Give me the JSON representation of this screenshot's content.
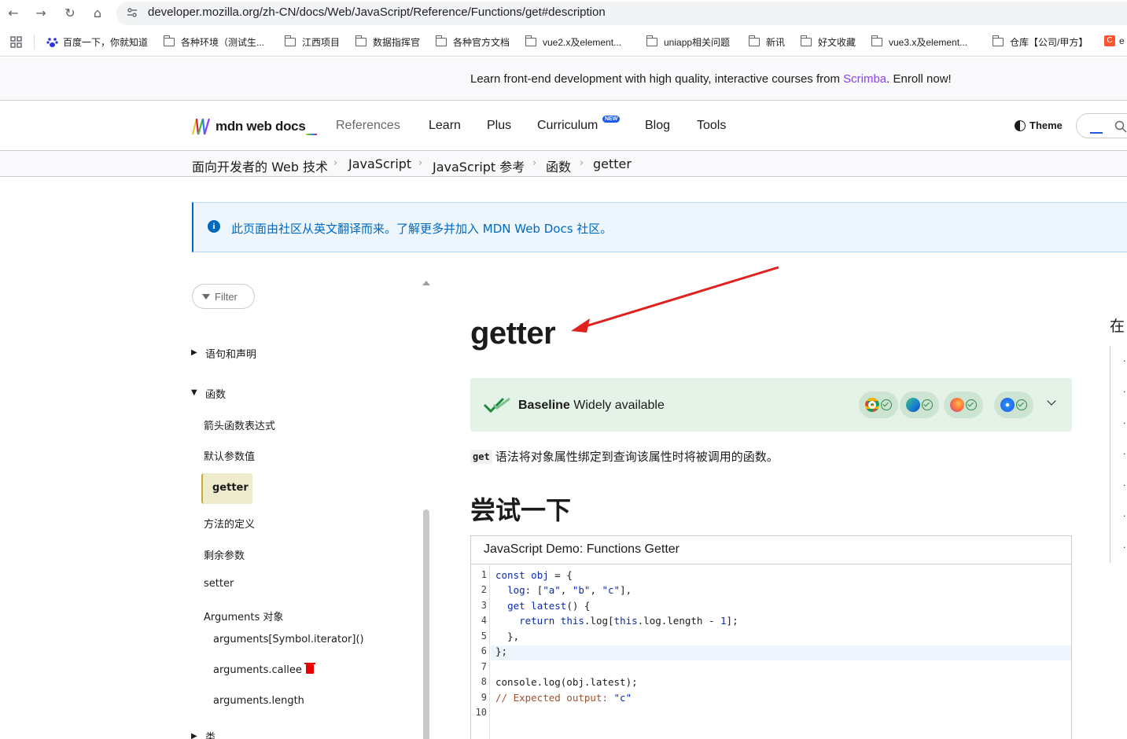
{
  "browser": {
    "url": "developer.mozilla.org/zh-CN/docs/Web/JavaScript/Reference/Functions/get#description",
    "bookmarks": [
      "百度一下，你就知道",
      "各种环境（测试生...",
      "江西项目",
      "数据指挥官",
      "各种官方文档",
      "vue2.x及element...",
      "uniapp相关问题",
      "新讯",
      "好文收藏",
      "vue3.x及element...",
      "仓库【公司/甲方】",
      "e"
    ]
  },
  "banner": {
    "prefix": "Learn front-end development with high quality, interactive courses from ",
    "link": "Scrimba",
    "suffix": ". Enroll now!"
  },
  "header": {
    "logo": "mdn web docs",
    "nav": [
      "References",
      "Learn",
      "Plus",
      "Curriculum",
      "Blog",
      "Tools"
    ],
    "new_badge": "NEW",
    "theme": "Theme"
  },
  "breadcrumb": [
    "面向开发者的 Web 技术",
    "JavaScript",
    "JavaScript 参考",
    "函数",
    "getter"
  ],
  "notice": {
    "text": "此页面由社区从英文翻译而来。了解更多并加入 MDN Web Docs 社区。"
  },
  "sidebar": {
    "filter": "Filter",
    "section_statements": "语句和声明",
    "section_functions": "函数",
    "items": [
      "箭头函数表达式",
      "默认参数值",
      "getter",
      "方法的定义",
      "剩余参数",
      "setter",
      "Arguments 对象"
    ],
    "sub_items": [
      "arguments[Symbol.iterator]()",
      "arguments.callee",
      "arguments.length"
    ],
    "section_classes": "类"
  },
  "main": {
    "title": "getter",
    "baseline_strong": "Baseline",
    "baseline_rest": " Widely available",
    "desc_code": "get",
    "desc_text": "语法将对象属性绑定到查询该属性时将被调用的函数。",
    "h2": "尝试一下",
    "demo_title": "JavaScript Demo: Functions Getter",
    "line_numbers": [
      "1",
      "2",
      "3",
      "4",
      "5",
      "6",
      "7",
      "8",
      "9",
      "10"
    ]
  },
  "toc": {
    "head": "在"
  },
  "colors": {
    "accent": "#1a5be8",
    "notice": "#0069c2",
    "baseline_bg": "#e4f2e7",
    "annotation_arrow": "#e0211d"
  }
}
